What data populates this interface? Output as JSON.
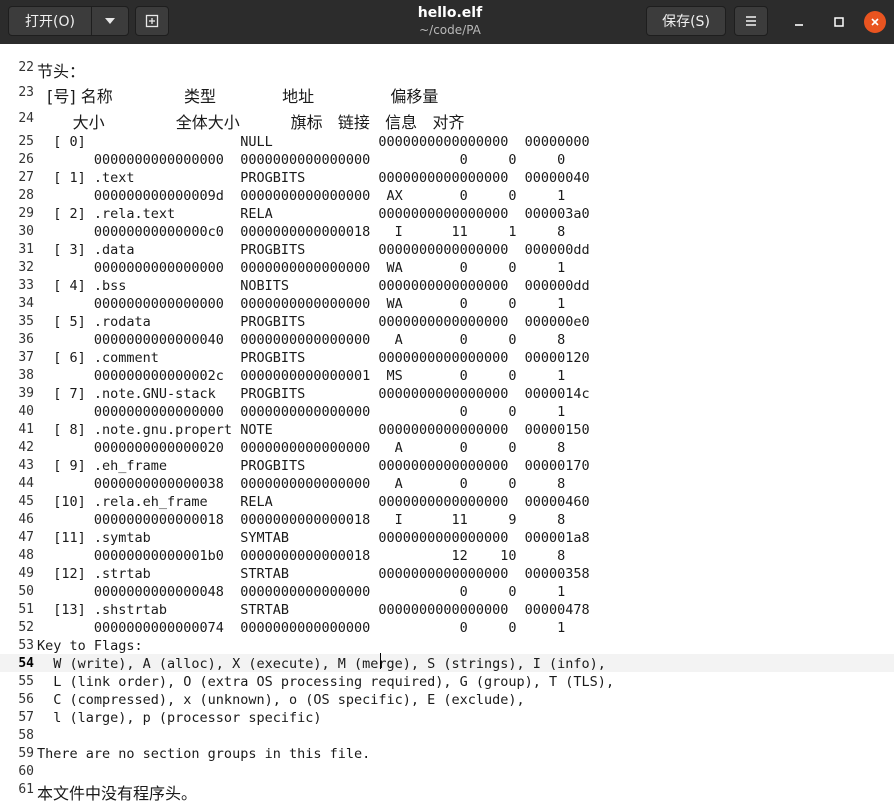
{
  "header": {
    "open_label": "打开(O)",
    "title": "hello.elf",
    "path": "~/code/PA",
    "save_label": "保存(S)"
  },
  "icons": {
    "open_menu": "chevron-down-icon",
    "new_tab": "new-document-icon",
    "menu": "hamburger-menu-icon",
    "minimize": "minimize-icon",
    "maximize": "maximize-icon",
    "close": "close-icon"
  },
  "colors": {
    "close_button": "#e95420",
    "titlebar": "#2c2c2c"
  },
  "editor": {
    "current_line": 54,
    "lines": [
      {
        "n": "22",
        "t": "节头："
      },
      {
        "n": "23",
        "t": "  [号] 名称              类型             地址               偏移量"
      },
      {
        "n": "24",
        "t": "       大小              全体大小          旗标   链接   信息   对齐"
      },
      {
        "n": "25",
        "t": "  [ 0]                   NULL             0000000000000000  00000000"
      },
      {
        "n": "26",
        "t": "       0000000000000000  0000000000000000           0     0     0"
      },
      {
        "n": "27",
        "t": "  [ 1] .text             PROGBITS         0000000000000000  00000040"
      },
      {
        "n": "28",
        "t": "       000000000000009d  0000000000000000  AX       0     0     1"
      },
      {
        "n": "29",
        "t": "  [ 2] .rela.text        RELA             0000000000000000  000003a0"
      },
      {
        "n": "30",
        "t": "       00000000000000c0  0000000000000018   I      11     1     8"
      },
      {
        "n": "31",
        "t": "  [ 3] .data             PROGBITS         0000000000000000  000000dd"
      },
      {
        "n": "32",
        "t": "       0000000000000000  0000000000000000  WA       0     0     1"
      },
      {
        "n": "33",
        "t": "  [ 4] .bss              NOBITS           0000000000000000  000000dd"
      },
      {
        "n": "34",
        "t": "       0000000000000000  0000000000000000  WA       0     0     1"
      },
      {
        "n": "35",
        "t": "  [ 5] .rodata           PROGBITS         0000000000000000  000000e0"
      },
      {
        "n": "36",
        "t": "       0000000000000040  0000000000000000   A       0     0     8"
      },
      {
        "n": "37",
        "t": "  [ 6] .comment          PROGBITS         0000000000000000  00000120"
      },
      {
        "n": "38",
        "t": "       000000000000002c  0000000000000001  MS       0     0     1"
      },
      {
        "n": "39",
        "t": "  [ 7] .note.GNU-stack   PROGBITS         0000000000000000  0000014c"
      },
      {
        "n": "40",
        "t": "       0000000000000000  0000000000000000           0     0     1"
      },
      {
        "n": "41",
        "t": "  [ 8] .note.gnu.propert NOTE             0000000000000000  00000150"
      },
      {
        "n": "42",
        "t": "       0000000000000020  0000000000000000   A       0     0     8"
      },
      {
        "n": "43",
        "t": "  [ 9] .eh_frame         PROGBITS         0000000000000000  00000170"
      },
      {
        "n": "44",
        "t": "       0000000000000038  0000000000000000   A       0     0     8"
      },
      {
        "n": "45",
        "t": "  [10] .rela.eh_frame    RELA             0000000000000000  00000460"
      },
      {
        "n": "46",
        "t": "       0000000000000018  0000000000000018   I      11     9     8"
      },
      {
        "n": "47",
        "t": "  [11] .symtab           SYMTAB           0000000000000000  000001a8"
      },
      {
        "n": "48",
        "t": "       00000000000001b0  0000000000000018          12    10     8"
      },
      {
        "n": "49",
        "t": "  [12] .strtab           STRTAB           0000000000000000  00000358"
      },
      {
        "n": "50",
        "t": "       0000000000000048  0000000000000000           0     0     1"
      },
      {
        "n": "51",
        "t": "  [13] .shstrtab         STRTAB           0000000000000000  00000478"
      },
      {
        "n": "52",
        "t": "       0000000000000074  0000000000000000           0     0     1"
      },
      {
        "n": "53",
        "t": "Key to Flags:"
      },
      {
        "n": "54",
        "t": "  W (write), A (alloc), X (execute), M (merge), S (strings), I (info),"
      },
      {
        "n": "55",
        "t": "  L (link order), O (extra OS processing required), G (group), T (TLS),"
      },
      {
        "n": "56",
        "t": "  C (compressed), x (unknown), o (OS specific), E (exclude),"
      },
      {
        "n": "57",
        "t": "  l (large), p (processor specific)"
      },
      {
        "n": "58",
        "t": ""
      },
      {
        "n": "59",
        "t": "There are no section groups in this file."
      },
      {
        "n": "60",
        "t": ""
      },
      {
        "n": "61",
        "t": "本文件中没有程序头。"
      }
    ]
  }
}
